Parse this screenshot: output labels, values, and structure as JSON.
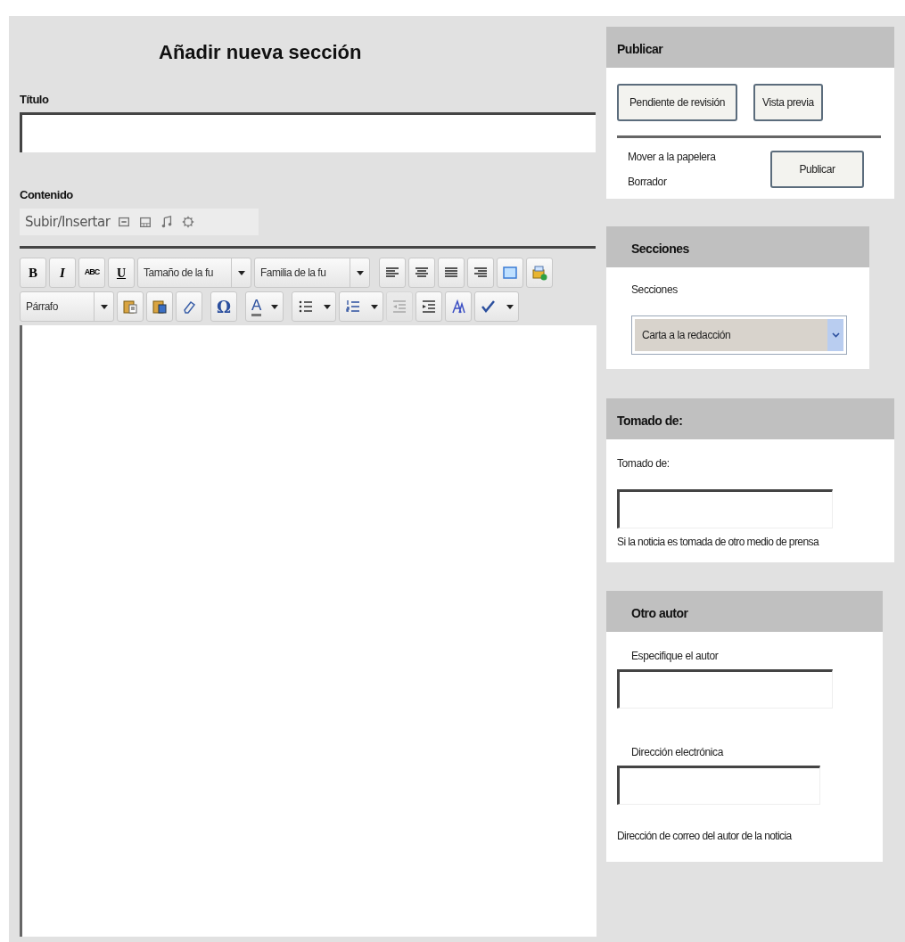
{
  "page_title": "Añadir nueva sección",
  "titulo": {
    "label": "Título"
  },
  "contenido": {
    "label": "Contenido",
    "upload_label": "Subir/Insertar"
  },
  "editor_toolbar": {
    "format_buttons": [
      {
        "label": "B",
        "kind": "bold"
      },
      {
        "label": "I",
        "kind": "italic"
      },
      {
        "label": "ABC",
        "kind": "strike"
      },
      {
        "label": "U",
        "kind": "underline"
      }
    ],
    "font_size_select": {
      "value": "Tamaño de la fu"
    },
    "font_family_select": {
      "value": "Familia de la fu"
    },
    "block_format_select": {
      "value": "Párrafo"
    },
    "special_character_button": {
      "label": "Ω"
    },
    "text_color_button": {
      "label": "A"
    },
    "outdent_button": {
      "disabled": true
    }
  },
  "publish_panel": {
    "title": "Publicar",
    "pending_review_button": "Pendiente de revisión",
    "preview_button": "Vista previa",
    "trash_link": "Mover a la papelera",
    "status": "Borrador",
    "publish_button": "Publicar"
  },
  "sections_panel": {
    "title": "Secciones",
    "label": "Secciones",
    "select_value": "Carta a la redacción"
  },
  "source_panel": {
    "title": "Tomado de:",
    "label": "Tomado de:",
    "help": "Si la noticia es tomada de otro medio de prensa"
  },
  "author_panel": {
    "title": "Otro autor",
    "author_label": "Especifique el autor",
    "email_label": "Dirección electrónica",
    "help": "Dirección de correo del autor de la noticia"
  }
}
